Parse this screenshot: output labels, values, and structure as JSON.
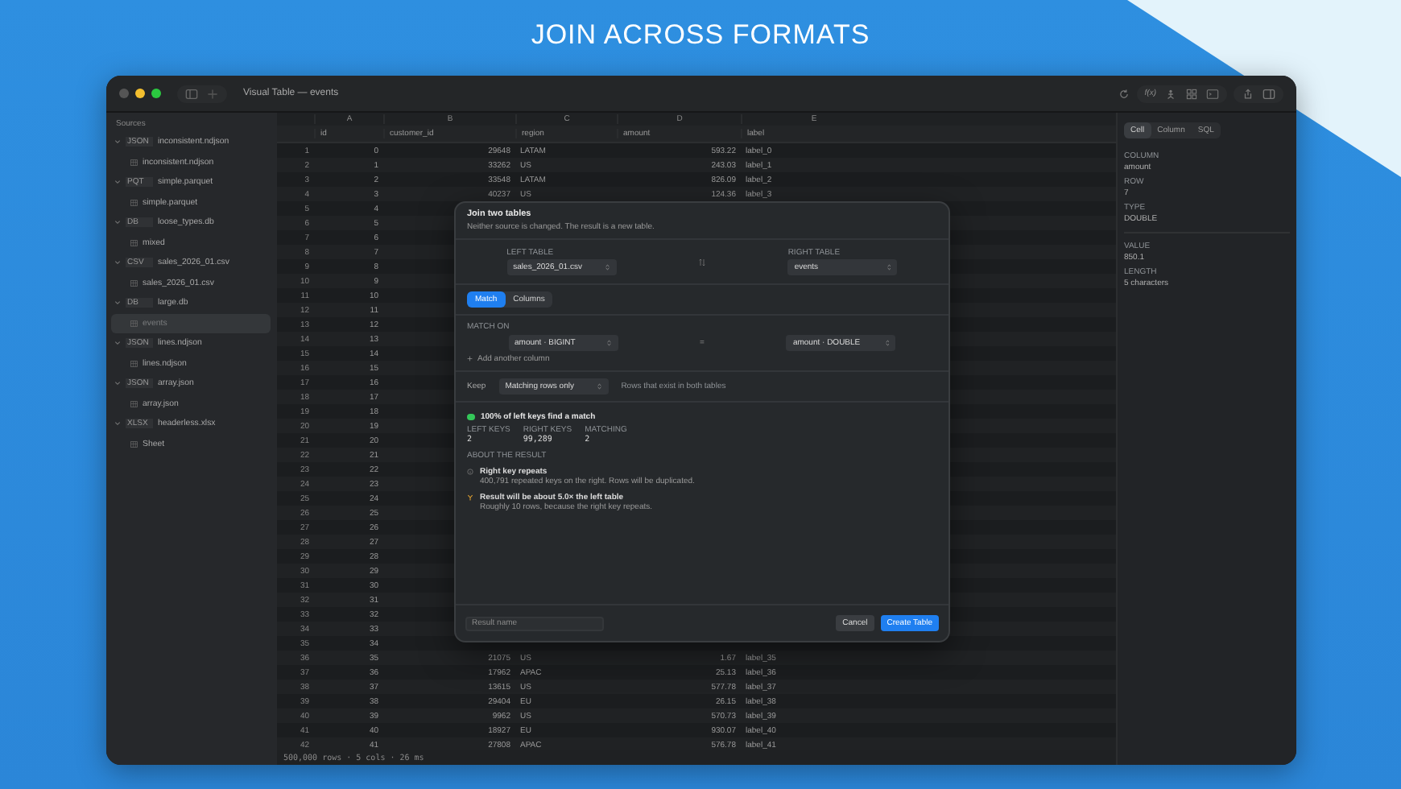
{
  "heading": "JOIN ACROSS FORMATS",
  "window": {
    "title": "Visual Table — events",
    "toolbar_text": "f(x)"
  },
  "sidebar": {
    "header": "Sources",
    "sources": [
      {
        "badge": "JSON",
        "name": "inconsistent.ndjson",
        "expanded": true,
        "children": [
          {
            "name": "inconsistent.ndjson",
            "selected": false
          }
        ]
      },
      {
        "badge": "PQT",
        "name": "simple.parquet",
        "expanded": true,
        "children": [
          {
            "name": "simple.parquet",
            "selected": false
          }
        ]
      },
      {
        "badge": "DB",
        "name": "loose_types.db",
        "expanded": true,
        "children": [
          {
            "name": "mixed",
            "selected": false
          }
        ]
      },
      {
        "badge": "CSV",
        "name": "sales_2026_01.csv",
        "expanded": true,
        "children": [
          {
            "name": "sales_2026_01.csv",
            "selected": false
          }
        ]
      },
      {
        "badge": "DB",
        "name": "large.db",
        "expanded": true,
        "children": [
          {
            "name": "events",
            "selected": true
          }
        ]
      },
      {
        "badge": "JSON",
        "name": "lines.ndjson",
        "expanded": true,
        "children": [
          {
            "name": "lines.ndjson",
            "selected": false
          }
        ]
      },
      {
        "badge": "JSON",
        "name": "array.json",
        "expanded": true,
        "children": [
          {
            "name": "array.json",
            "selected": false
          }
        ]
      },
      {
        "badge": "XLSX",
        "name": "headerless.xlsx",
        "expanded": true,
        "children": [
          {
            "name": "Sheet",
            "selected": false
          }
        ]
      }
    ]
  },
  "table": {
    "letters": [
      "A",
      "B",
      "C",
      "D",
      "E"
    ],
    "columns": [
      "id",
      "customer_id",
      "region",
      "amount",
      "label"
    ],
    "rows": [
      {
        "n": "1",
        "cells": [
          "0",
          "29648",
          "LATAM",
          "593.22",
          "label_0"
        ]
      },
      {
        "n": "2",
        "cells": [
          "1",
          "33262",
          "US",
          "243.03",
          "label_1"
        ]
      },
      {
        "n": "3",
        "cells": [
          "2",
          "33548",
          "LATAM",
          "826.09",
          "label_2"
        ]
      },
      {
        "n": "4",
        "cells": [
          "3",
          "40237",
          "US",
          "124.36",
          "label_3"
        ]
      },
      {
        "n": "5",
        "cells": [
          "4"
        ]
      },
      {
        "n": "6",
        "cells": [
          "5"
        ]
      },
      {
        "n": "7",
        "cells": [
          "6"
        ]
      },
      {
        "n": "8",
        "cells": [
          "7"
        ]
      },
      {
        "n": "9",
        "cells": [
          "8"
        ]
      },
      {
        "n": "10",
        "cells": [
          "9"
        ]
      },
      {
        "n": "11",
        "cells": [
          "10"
        ]
      },
      {
        "n": "12",
        "cells": [
          "11"
        ]
      },
      {
        "n": "13",
        "cells": [
          "12"
        ]
      },
      {
        "n": "14",
        "cells": [
          "13"
        ]
      },
      {
        "n": "15",
        "cells": [
          "14"
        ]
      },
      {
        "n": "16",
        "cells": [
          "15"
        ]
      },
      {
        "n": "17",
        "cells": [
          "16"
        ]
      },
      {
        "n": "18",
        "cells": [
          "17"
        ]
      },
      {
        "n": "19",
        "cells": [
          "18"
        ]
      },
      {
        "n": "20",
        "cells": [
          "19"
        ]
      },
      {
        "n": "21",
        "cells": [
          "20"
        ]
      },
      {
        "n": "22",
        "cells": [
          "21"
        ]
      },
      {
        "n": "23",
        "cells": [
          "22"
        ]
      },
      {
        "n": "24",
        "cells": [
          "23"
        ]
      },
      {
        "n": "25",
        "cells": [
          "24"
        ]
      },
      {
        "n": "26",
        "cells": [
          "25"
        ]
      },
      {
        "n": "27",
        "cells": [
          "26"
        ]
      },
      {
        "n": "28",
        "cells": [
          "27"
        ]
      },
      {
        "n": "29",
        "cells": [
          "28"
        ]
      },
      {
        "n": "30",
        "cells": [
          "29"
        ]
      },
      {
        "n": "31",
        "cells": [
          "30"
        ]
      },
      {
        "n": "32",
        "cells": [
          "31"
        ]
      },
      {
        "n": "33",
        "cells": [
          "32"
        ]
      },
      {
        "n": "34",
        "cells": [
          "33"
        ]
      },
      {
        "n": "35",
        "cells": [
          "34"
        ]
      },
      {
        "n": "36",
        "cells": [
          "35",
          "21075",
          "US",
          "1.67",
          "label_35"
        ]
      },
      {
        "n": "37",
        "cells": [
          "36",
          "17962",
          "APAC",
          "25.13",
          "label_36"
        ]
      },
      {
        "n": "38",
        "cells": [
          "37",
          "13615",
          "US",
          "577.78",
          "label_37"
        ]
      },
      {
        "n": "39",
        "cells": [
          "38",
          "29404",
          "EU",
          "26.15",
          "label_38"
        ]
      },
      {
        "n": "40",
        "cells": [
          "39",
          "9962",
          "US",
          "570.73",
          "label_39"
        ]
      },
      {
        "n": "41",
        "cells": [
          "40",
          "18927",
          "EU",
          "930.07",
          "label_40"
        ]
      },
      {
        "n": "42",
        "cells": [
          "41",
          "27808",
          "APAC",
          "576.78",
          "label_41"
        ]
      }
    ]
  },
  "status_bar": "500,000 rows · 5 cols · 26 ms",
  "inspector": {
    "tabs": [
      {
        "label": "Cell",
        "selected": true
      },
      {
        "label": "Column",
        "selected": false
      },
      {
        "label": "SQL",
        "selected": false
      }
    ],
    "fields": [
      {
        "label": "COLUMN",
        "value": "amount"
      },
      {
        "label": "ROW",
        "value": "7"
      },
      {
        "label": "TYPE",
        "value": "DOUBLE"
      },
      {
        "label": "VALUE",
        "value": "850.1"
      },
      {
        "label": "LENGTH",
        "value": "5 characters"
      }
    ]
  },
  "dialog": {
    "title": "Join two tables",
    "subtitle": "Neither source is changed. The result is a new table.",
    "left_table": {
      "label": "LEFT TABLE",
      "value": "sales_2026_01.csv"
    },
    "right_table": {
      "label": "RIGHT TABLE",
      "value": "events"
    },
    "tabs": [
      {
        "label": "Match",
        "selected": true
      },
      {
        "label": "Columns",
        "selected": false
      }
    ],
    "match_label": "MATCH ON",
    "left_key": "amount · BIGINT",
    "equals": "=",
    "right_key": "amount · DOUBLE",
    "add_column": "Add another column",
    "keep_label": "Keep",
    "keep_value": "Matching rows only",
    "keep_hint": "Rows that exist in both tables",
    "status": {
      "text": "100% of left keys find a match",
      "color": "#34c759"
    },
    "stats": [
      {
        "label": "LEFT KEYS",
        "value": "2"
      },
      {
        "label": "RIGHT KEYS",
        "value": "99,289"
      },
      {
        "label": "MATCHING",
        "value": "2"
      }
    ],
    "about_label": "ABOUT THE RESULT",
    "notes": [
      {
        "kind": "info",
        "title": "Right key repeats",
        "detail": "400,791 repeated keys on the right. Rows will be duplicated."
      },
      {
        "kind": "warning",
        "title": "Result will be about 5.0× the left table",
        "detail": "Roughly 10 rows, because the right key repeats."
      }
    ],
    "result_placeholder": "Result name",
    "cancel": "Cancel",
    "create": "Create Table"
  }
}
